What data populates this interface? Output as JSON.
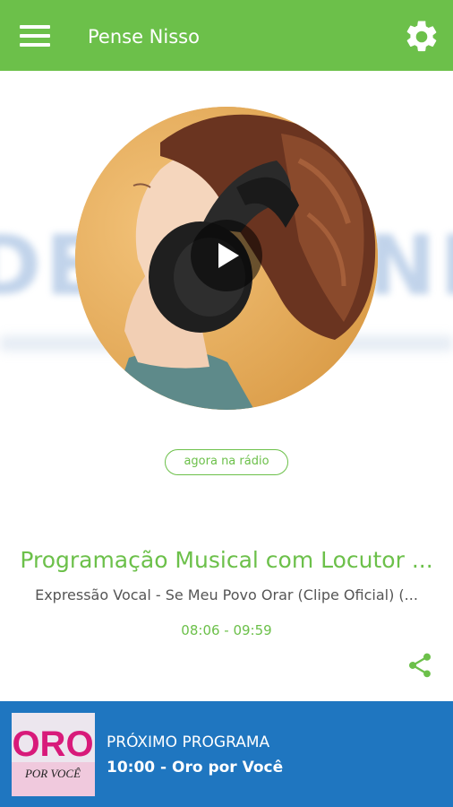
{
  "appbar": {
    "title": "Pense Nisso",
    "menu_icon": "menu-icon",
    "settings_icon": "gear-icon",
    "color": "#6cc04a"
  },
  "background": {
    "word_left": "DE",
    "word_right": "NI"
  },
  "player": {
    "play_icon": "play-icon",
    "badge": "agora na rádio",
    "program_title": "Programação Musical com Locutor ...",
    "song": "Expressão Vocal - Se Meu Povo Orar (Clipe Oficial) (...",
    "time": "08:06 - 09:59",
    "share_icon": "share-icon"
  },
  "next_program": {
    "label": "PRÓXIMO PROGRAMA",
    "title": "10:00 - Oro por Você",
    "thumb_text_top": "ORO",
    "thumb_text_bottom": "POR VOCÊ",
    "bar_color": "#1f76c0"
  }
}
